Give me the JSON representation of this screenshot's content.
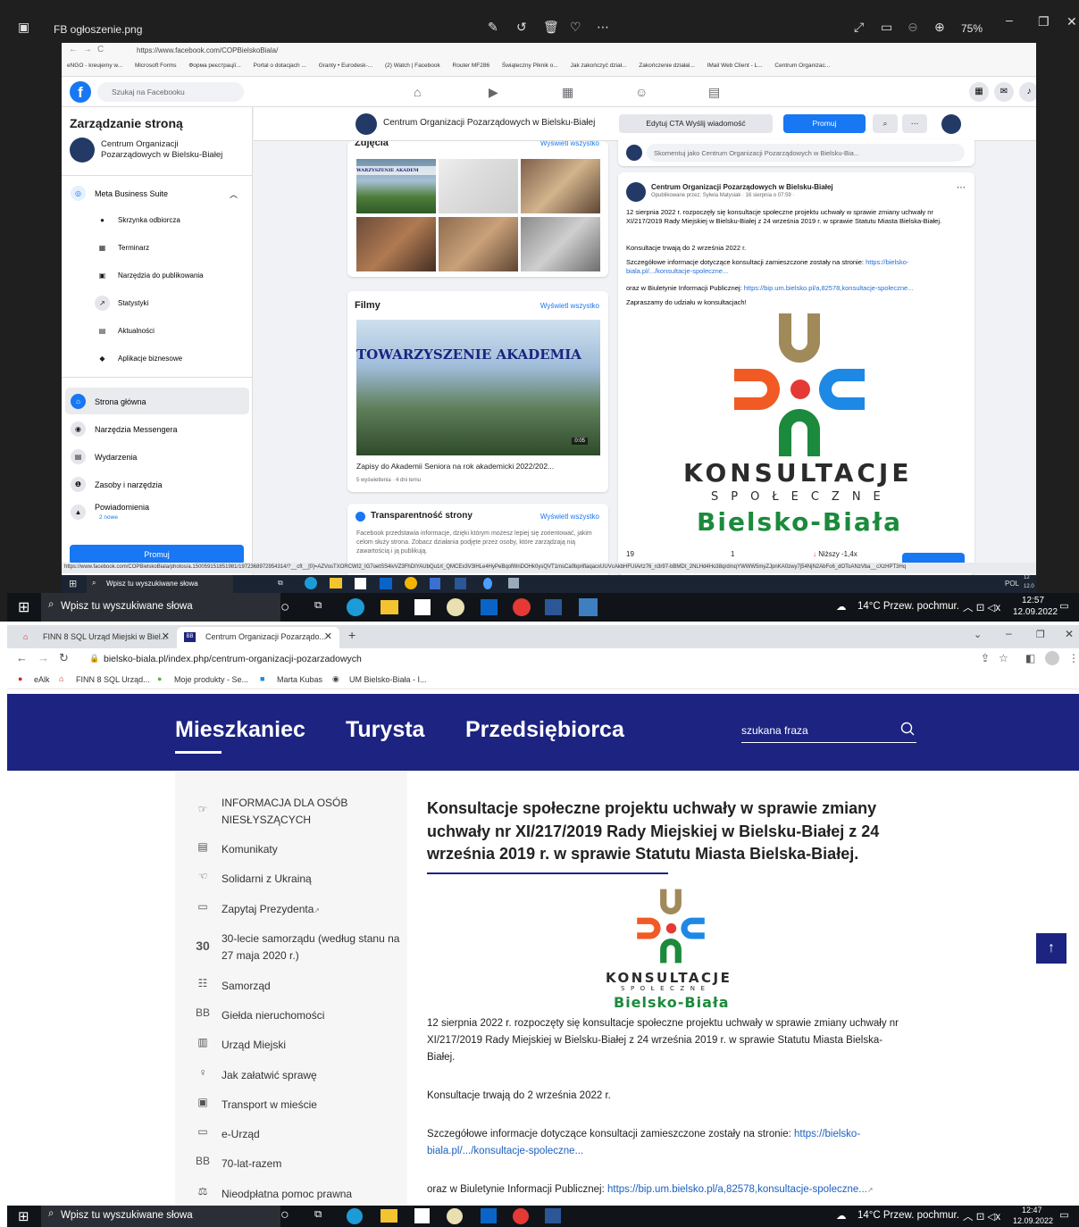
{
  "viewer": {
    "filename": "FB ogłoszenie.png",
    "zoom": "75%"
  },
  "fb_chrome": {
    "url": "https://www.facebook.com/COPBielskoBiala/",
    "bookmarks": [
      "eNGO - kreujemy w...",
      "Microsoft Forms",
      "Форма реєстрації...",
      "Portal o dotacjach ...",
      "Granty • Eurodesk-...",
      "(2) Watch | Facebook",
      "Router MF286",
      "Świąteczny Piknik o...",
      "Jak zakończyć dział...",
      "Zakończenie działal...",
      "IMail Web Client - L...",
      "Centrum Organizac..."
    ]
  },
  "fb": {
    "search_placeholder": "Szukaj na Facebooku",
    "sidebar_heading": "Zarządzanie stroną",
    "page_name_line1": "Centrum Organizacji",
    "page_name_line2": "Pozarządowych w Bielsku-Białej",
    "meta_suite": "Meta Business Suite",
    "suite_items": [
      "Skrzynka odbiorcza",
      "Terminarz",
      "Narzędzia do publikowania",
      "Statystyki",
      "Aktualności",
      "Aplikacje biznesowe"
    ],
    "main_items": [
      "Strona główna",
      "Narzędzia Messengera",
      "Wydarzenia",
      "Zasoby i narzędzia",
      "Powiadomienia"
    ],
    "notifications_count": "2 nowe",
    "promote": "Promuj",
    "page_title": "Centrum Organizacji Pozarządowych w Bielsku-Białej",
    "edit_cta": "Edytuj CTA Wyślij wiadomość",
    "promote_btn": "Promuj",
    "photos_title": "Zdjęcia",
    "see_all": "Wyświetl wszystko",
    "photo_banner": "WARZYSZENIE AKADEM",
    "films_title": "Filmy",
    "video_banner": "TOWARZYSZENIE AKADEMIA",
    "video_duration": "0:05",
    "video_title": "Zapisy do Akademii Seniora na rok akademicki 2022/202...",
    "video_meta": "5 wyświetlenia · 4 dni temu",
    "transparency_title": "Transparentność strony",
    "transparency_text": "Facebook przedstawia informacje, dzięki którym możesz lepiej się zorientować, jakim celom służy strona. Zobacz działania podjęte przez osoby, które zarządzają nią zawartością i ją publikują.",
    "comment_placeholder": "Skomentuj jako Centrum Organizacji Pozarządowych w Bielsku-Bia...",
    "post_author": "Centrum Organizacji Pozarządowych w Bielsku-Białej",
    "post_meta": "Opublikowane przez: Sylwia Matysiak · 16 sierpnia o 07:59 ·",
    "post_p1": "12 sierpnia 2022 r. rozpoczęły się konsultacje społeczne projektu uchwały w sprawie zmiany uchwały nr XI/217/2019 Rady Miejskiej w Bielsku-Białej z 24 września 2019 r. w sprawie Statutu Miasta Bielska-Białej.",
    "post_p2": "Konsultacje trwają do 2 września 2022 r.",
    "post_p3a": "Szczegółowe informacje dotyczące konsultacji zamieszczone zostały na stronie:",
    "post_p3b": "https://bielsko-biala.pl/.../konsultacje-spoleczne...",
    "post_p4a": "oraz w Biuletynie Informacji Publicznej:",
    "post_p4b": "https://bip.um.bielsko.pl/a,82578,konsultacje-spoleczne...",
    "post_p5": "Zapraszamy do udziału w konsultacjach!",
    "stat_left": "19",
    "stat_mid": "1",
    "stat_right": "Niższy -1,4x",
    "status_url": "https://www.facebook.com/COPBielskoBiala/photos/a.150059151851981/1972368972954314/?__cft__[0]=AZVosTXORCWI2_IG7oetSS4ivVZ3FhDIYAUbQu1rt_QMCEx3V3lHLe4HyPeBqofWnDOHk0ysQVT1msCa0bpriflaqacxUUVcAkbHFUIArtz76_n3r97-bBMDt_2NLHd4Ho38qrdmqYWWW5myZJpnKA0zwy7j54NjN2AbFo6_dOToANzVba__cXzHPT3Hq"
  },
  "logo": {
    "word": "KONSULTACJE",
    "sub": "SPOŁECZNE",
    "city": "Bielsko-Biała"
  },
  "taskbar": {
    "search_placeholder": "Wpisz tu wyszukiwane słowa",
    "weather": "14°C  Przew. pochmur.",
    "lang": "POL",
    "time1": "12:57",
    "date1": "12.09.2022",
    "time2": "12:47",
    "date2": "12.09.2022",
    "inner_time": "12",
    "inner_date": "12.0"
  },
  "browser2": {
    "tab1": "FINN 8 SQL Urząd Miejski w Biel...",
    "tab2": "Centrum Organizacji Pozarządo...",
    "url": "bielsko-biala.pl/index.php/centrum-organizacji-pozarzadowych",
    "bookmarks": [
      "eAlk",
      "FINN 8 SQL Urząd...",
      "Moje produkty - Se...",
      "Marta Kubas",
      "UM Bielsko-Biała - I..."
    ]
  },
  "site": {
    "nav": [
      "Mieszkaniec",
      "Turysta",
      "Przedsiębiorca"
    ],
    "search_placeholder": "szukana fraza",
    "menu": [
      "INFORMACJA DLA OSÓB NIESŁYSZĄCYCH",
      "Komunikaty",
      "Solidarni z Ukrainą",
      "Zapytaj Prezydenta",
      "30-lecie samorządu (według stanu na 27 maja 2020 r.)",
      "Samorząd",
      "Giełda nieruchomości",
      "Urząd Miejski",
      "Jak załatwić sprawę",
      "Transport w mieście",
      "e-Urząd",
      "70-lat-razem",
      "Nieodpłatna pomoc prawna"
    ],
    "title": "Konsultacje społeczne projektu uchwały w sprawie zmiany uchwały nr XI/217/2019 Rady Miejskiej w Bielsku-Białej z 24 września 2019 r. w sprawie Statutu Miasta Bielska-Białej.",
    "p1": "12 sierpnia 2022 r. rozpoczęty się konsultacje społeczne projektu uchwały w sprawie zmiany uchwały nr XI/217/2019 Rady Miejskiej w Bielsku-Białej z 24 września 2019 r. w sprawie Statutu Miasta Bielska-Białej.",
    "p2": "Konsultacje trwają do 2 września 2022 r.",
    "p3a": "Szczegółowe informacje dotyczące konsultacji zamieszczone zostały na stronie: ",
    "p3b": "https://bielsko-biala.pl/.../konsultacje-spoleczne...",
    "p4a": "oraz w Biuletynie Informacji Publicznej: ",
    "p4b": "https://bip.um.bielsko.pl/a,82578,konsultacje-spoleczne..."
  },
  "colors": {
    "fb_blue": "#1877f2",
    "site_navy": "#1c2380",
    "logo_orange": "#f15a24",
    "logo_blue": "#1e88e5",
    "logo_green": "#1b8a3c",
    "logo_gold": "#a08a5a"
  }
}
